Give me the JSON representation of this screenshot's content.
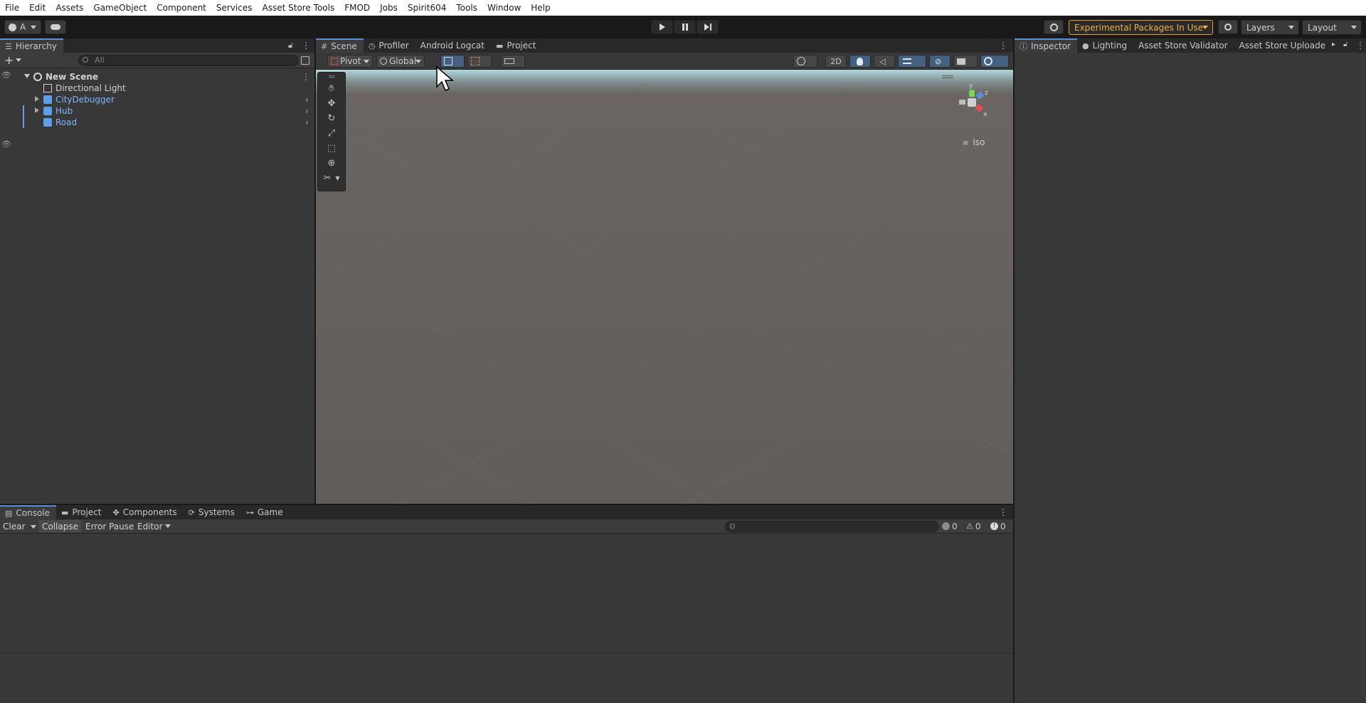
{
  "menu": [
    "File",
    "Edit",
    "Assets",
    "GameObject",
    "Component",
    "Services",
    "Asset Store Tools",
    "FMOD",
    "Jobs",
    "Spirit604",
    "Tools",
    "Window",
    "Help"
  ],
  "toolbar": {
    "account_label": "A",
    "experimental_label": "Experimental Packages In Use",
    "layers_label": "Layers",
    "layout_label": "Layout"
  },
  "hierarchy": {
    "tab_label": "Hierarchy",
    "search_placeholder": "All",
    "scene_name": "New Scene",
    "items": [
      {
        "label": "Directional Light",
        "prefab": false
      },
      {
        "label": "CityDebugger",
        "prefab": true
      },
      {
        "label": "Hub",
        "prefab": true
      },
      {
        "label": "Road",
        "prefab": true
      }
    ]
  },
  "scene_tabs": [
    "Scene",
    "Profiler",
    "Android Logcat",
    "Project"
  ],
  "scene_toolbar": {
    "pivot_label": "Pivot",
    "global_label": "Global",
    "mode_2d_label": "2D"
  },
  "scene_view": {
    "projection_label": "Iso",
    "gizmo_axes": {
      "y": "y",
      "z": "z",
      "x": "x"
    }
  },
  "inspector_tabs": [
    "Inspector",
    "Lighting",
    "Asset Store Validator",
    "Asset Store Uploade"
  ],
  "bottom_tabs": [
    "Console",
    "Project",
    "Components",
    "Systems",
    "Game"
  ],
  "console": {
    "clear_label": "Clear",
    "collapse_label": "Collapse",
    "error_pause_label": "Error Pause",
    "editor_label": "Editor",
    "info_count": "0",
    "warning_count": "0",
    "error_count": "0"
  },
  "colors": {
    "accent": "#5a8ed8",
    "warning": "#e8a02c",
    "prefab_text": "#7eb6ff"
  }
}
